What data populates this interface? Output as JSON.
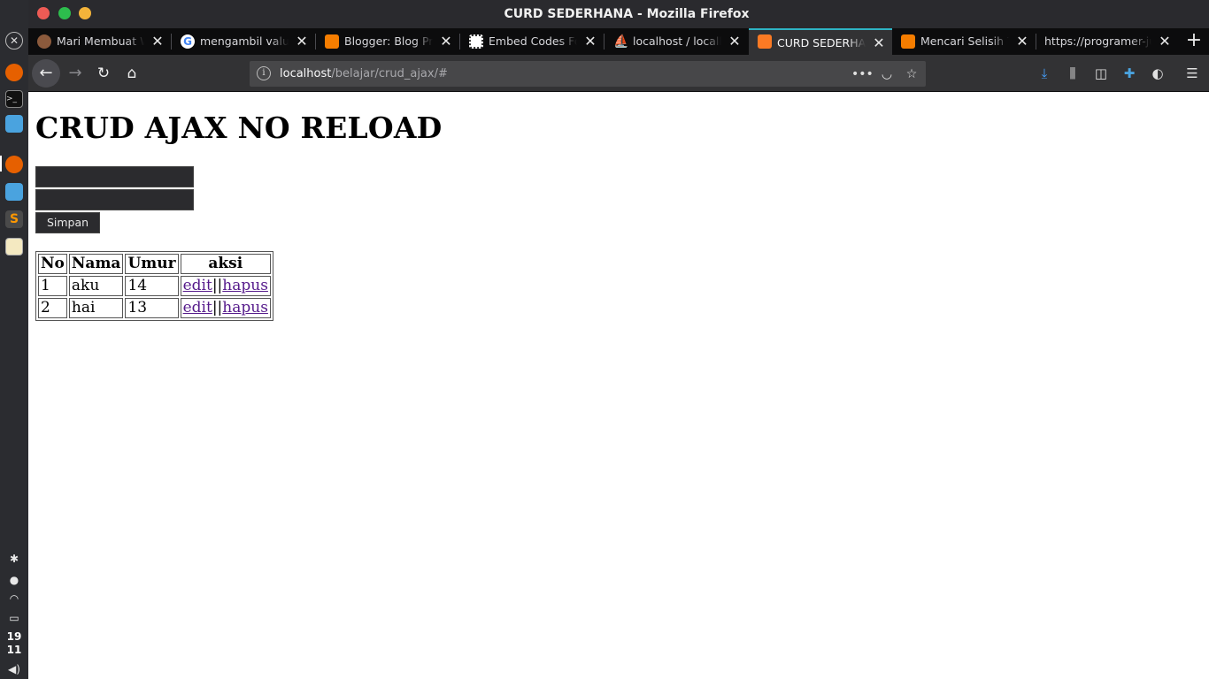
{
  "window": {
    "title": "CURD SEDERHANA - Mozilla Firefox"
  },
  "dock": {
    "clock_hour": "19",
    "clock_minute": "11"
  },
  "tabs": [
    {
      "label": "Mari Membuat Web",
      "favicon": "avatar-icon",
      "color": "#8b5a3c"
    },
    {
      "label": "mengambil value dari",
      "favicon": "google-icon",
      "color": "#ffffff"
    },
    {
      "label": "Blogger: Blog Pribadi",
      "favicon": "blogger-icon",
      "color": "#f57d00"
    },
    {
      "label": "Embed Codes For Web",
      "favicon": "qr-icon",
      "color": "#ffffff"
    },
    {
      "label": "localhost / localhost",
      "favicon": "phpmyadmin-icon",
      "color": "#f2a900"
    },
    {
      "label": "CURD SEDERHANA",
      "favicon": "xampp-icon",
      "color": "#fb7a24",
      "selected": true
    },
    {
      "label": "Mencari Selisih Tanggal",
      "favicon": "blogger-icon",
      "color": "#f57d00"
    },
    {
      "label": "https://programer-junior",
      "favicon": "",
      "color": ""
    }
  ],
  "url": {
    "host": "localhost",
    "path": "/belajar/crud_ajax/#"
  },
  "page": {
    "title": "CRUD AJAX NO RELOAD",
    "save_label": "Simpan",
    "table": {
      "headers": [
        "No",
        "Nama",
        "Umur",
        "aksi"
      ],
      "rows": [
        {
          "no": "1",
          "nama": "aku",
          "umur": "14",
          "edit": "edit",
          "sep": "||",
          "hapus": "hapus"
        },
        {
          "no": "2",
          "nama": "hai",
          "umur": "13",
          "edit": "edit",
          "sep": "||",
          "hapus": "hapus"
        }
      ]
    }
  },
  "colors": {
    "accent": "#2eb3c4",
    "link_visited": "#551a8b",
    "input_bg": "#2b2b2e"
  }
}
